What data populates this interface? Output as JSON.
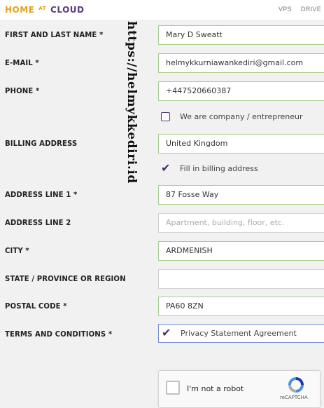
{
  "header": {
    "logo": {
      "part1": "HOME",
      "part2": "AT",
      "part3": "CLOUD"
    },
    "nav": [
      "VPS",
      "DRIVE"
    ]
  },
  "watermark": "https://helmykkediri.id",
  "form": {
    "name": {
      "label": "FIRST AND LAST NAME *",
      "value": "Mary D Sweatt"
    },
    "email": {
      "label": "E-MAIL *",
      "value": "helmykkurniawankediri@gmail.com"
    },
    "phone": {
      "label": "PHONE *",
      "value": "+447520660387"
    },
    "company": {
      "label": "We are company / entrepreneur",
      "checked": false
    },
    "billing": {
      "label": "BILLING ADDRESS",
      "value": "United Kingdom"
    },
    "fill_billing": {
      "label": "Fill in billing address",
      "checked": true
    },
    "address1": {
      "label": "ADDRESS LINE 1 *",
      "value": "87  Fosse Way"
    },
    "address2": {
      "label": "ADDRESS LINE 2",
      "placeholder": "Apartment, building, floor, etc."
    },
    "city": {
      "label": "CITY *",
      "value": "ARDMENISH"
    },
    "state": {
      "label": "STATE / PROVINCE OR REGION",
      "value": ""
    },
    "postal": {
      "label": "POSTAL CODE *",
      "value": "PA60 8ZN"
    },
    "terms": {
      "label": "TERMS AND CONDITIONS *",
      "agreement": "Privacy Statement Agreement",
      "checked": true
    }
  },
  "captcha": {
    "text": "I'm not a robot",
    "brand": "reCAPTCHA"
  },
  "colors": {
    "accent": "#5b3a7a",
    "logo_orange": "#e3a21a",
    "valid_border": "#a8cf8f"
  }
}
